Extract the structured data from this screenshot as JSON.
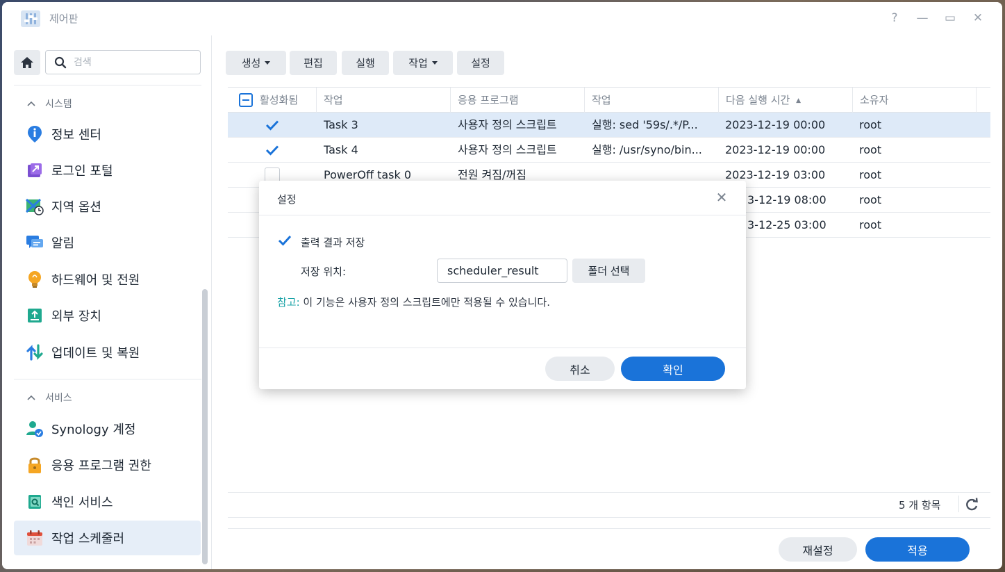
{
  "window": {
    "title": "제어판",
    "controls": {
      "help": "?",
      "minimize": "—",
      "maximize": "▭",
      "close": "✕"
    }
  },
  "sidebar": {
    "search_placeholder": "검색",
    "sections": [
      {
        "label": "시스템",
        "items": [
          {
            "label": "정보 센터",
            "icon": "info-icon"
          },
          {
            "label": "로그인 포털",
            "icon": "login-portal-icon"
          },
          {
            "label": "지역 옵션",
            "icon": "region-icon"
          },
          {
            "label": "알림",
            "icon": "notification-icon"
          },
          {
            "label": "하드웨어 및 전원",
            "icon": "hardware-power-icon"
          },
          {
            "label": "외부 장치",
            "icon": "external-device-icon"
          },
          {
            "label": "업데이트 및 복원",
            "icon": "update-restore-icon"
          }
        ]
      },
      {
        "label": "서비스",
        "items": [
          {
            "label": "Synology 계정",
            "icon": "synology-account-icon"
          },
          {
            "label": "응용 프로그램 권한",
            "icon": "app-privileges-icon"
          },
          {
            "label": "색인 서비스",
            "icon": "indexing-service-icon"
          },
          {
            "label": "작업 스케줄러",
            "icon": "task-scheduler-icon",
            "active": true
          }
        ]
      }
    ]
  },
  "toolbar": {
    "create": "생성",
    "edit": "편집",
    "run": "실행",
    "action": "작업",
    "settings": "설정"
  },
  "table": {
    "columns": [
      "활성화됨",
      "작업",
      "응용 프로그램",
      "작업",
      "다음 실행 시간",
      "소유자"
    ],
    "sort_indicator": "▲",
    "rows": [
      {
        "enabled": true,
        "task": "Task 3",
        "app": "사용자 정의 스크립트",
        "action": "실행: sed '59s/.*/P...",
        "next_run": "2023-12-19 00:00",
        "owner": "root",
        "selected": true
      },
      {
        "enabled": true,
        "task": "Task 4",
        "app": "사용자 정의 스크립트",
        "action": "실행: /usr/syno/bin...",
        "next_run": "2023-12-19 00:00",
        "owner": "root",
        "selected": false
      },
      {
        "enabled": false,
        "task": "PowerOff task 0",
        "app": "전원 켜짐/꺼짐",
        "action": "",
        "next_run": "2023-12-19 03:00",
        "owner": "root",
        "selected": false
      },
      {
        "enabled": null,
        "task": "",
        "app": "",
        "action": "",
        "next_run": "3-12-19 08:00",
        "owner": "root",
        "selected": false
      },
      {
        "enabled": null,
        "task": "",
        "app": "",
        "action": "",
        "next_run": "3-12-25 03:00",
        "owner": "root",
        "selected": false
      }
    ],
    "count": "5 개 항목"
  },
  "footer": {
    "reset": "재설정",
    "apply": "적용"
  },
  "dialog": {
    "title": "설정",
    "save_output_label": "출력 결과 저장",
    "save_output_checked": true,
    "location_label": "저장 위치:",
    "location_value": "scheduler_result",
    "folder_button": "폴더 선택",
    "note_prefix": "참고:",
    "note_text": " 이 기능은 사용자 정의 스크립트에만 적용될 수 있습니다.",
    "cancel": "취소",
    "ok": "확인"
  },
  "colors": {
    "accent": "#1a73d9",
    "note": "#17a2a6",
    "selected_row": "#deeaf8"
  }
}
